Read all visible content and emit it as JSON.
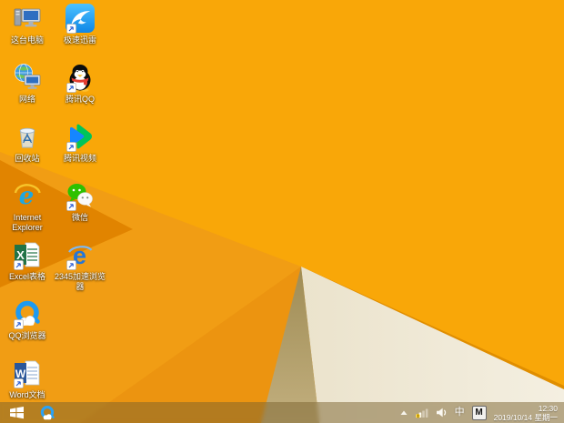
{
  "wallpaper": {
    "name": "windows-8.1-default-orange",
    "colors": {
      "orange_bright": "#F9A708",
      "orange_base": "#F19D14",
      "orange_facet": "#EC9410",
      "orange_dart": "#E18400",
      "fold_line": "#E08E00",
      "cream": "#EFE8D4",
      "olive_shadow": "#AE9A66",
      "taskbar_tint": "rgba(122,98,46,0.5)"
    }
  },
  "desktop": {
    "icons": [
      {
        "name": "this-pc",
        "label": "这台电脑",
        "icon": "computer-icon",
        "shortcut": false
      },
      {
        "name": "network",
        "label": "网络",
        "icon": "network-globe-icon",
        "shortcut": false
      },
      {
        "name": "recycle-bin",
        "label": "回收站",
        "icon": "recycle-bin-icon",
        "shortcut": false
      },
      {
        "name": "internet-explorer",
        "label": "Internet Explorer",
        "icon": "ie-icon",
        "shortcut": false
      },
      {
        "name": "excel",
        "label": "Excel表格",
        "icon": "excel-icon",
        "shortcut": true
      },
      {
        "name": "qq-browser",
        "label": "QQ浏览器",
        "icon": "qq-browser-icon",
        "shortcut": true
      },
      {
        "name": "word",
        "label": "Word文档",
        "icon": "word-icon",
        "shortcut": true
      },
      {
        "name": "thunder",
        "label": "极速迅雷",
        "icon": "thunder-icon",
        "shortcut": true
      },
      {
        "name": "tencent-qq",
        "label": "腾讯QQ",
        "icon": "qq-penguin-icon",
        "shortcut": true
      },
      {
        "name": "tencent-video",
        "label": "腾讯视频",
        "icon": "tencent-video-icon",
        "shortcut": true
      },
      {
        "name": "wechat",
        "label": "微信",
        "icon": "wechat-icon",
        "shortcut": true
      },
      {
        "name": "browser-2345",
        "label": "2345加速浏览器",
        "icon": "e-browser-icon",
        "shortcut": true
      }
    ],
    "icon_glyphs": {
      "ie_e": "e",
      "b2345_e": "e",
      "excel_x": "X",
      "word_w": "W"
    }
  },
  "taskbar": {
    "start": {
      "icon": "windows-logo-icon"
    },
    "pinned": [
      {
        "name": "qq-browser",
        "icon": "qq-browser-icon"
      }
    ],
    "tray": {
      "icons": [
        "chevron-up-icon",
        "network-signal-warning-icon",
        "volume-icon"
      ],
      "ime_zh": "中",
      "ime_mode": "M",
      "time": "12:30",
      "date": "2019/10/14 星期一"
    }
  }
}
